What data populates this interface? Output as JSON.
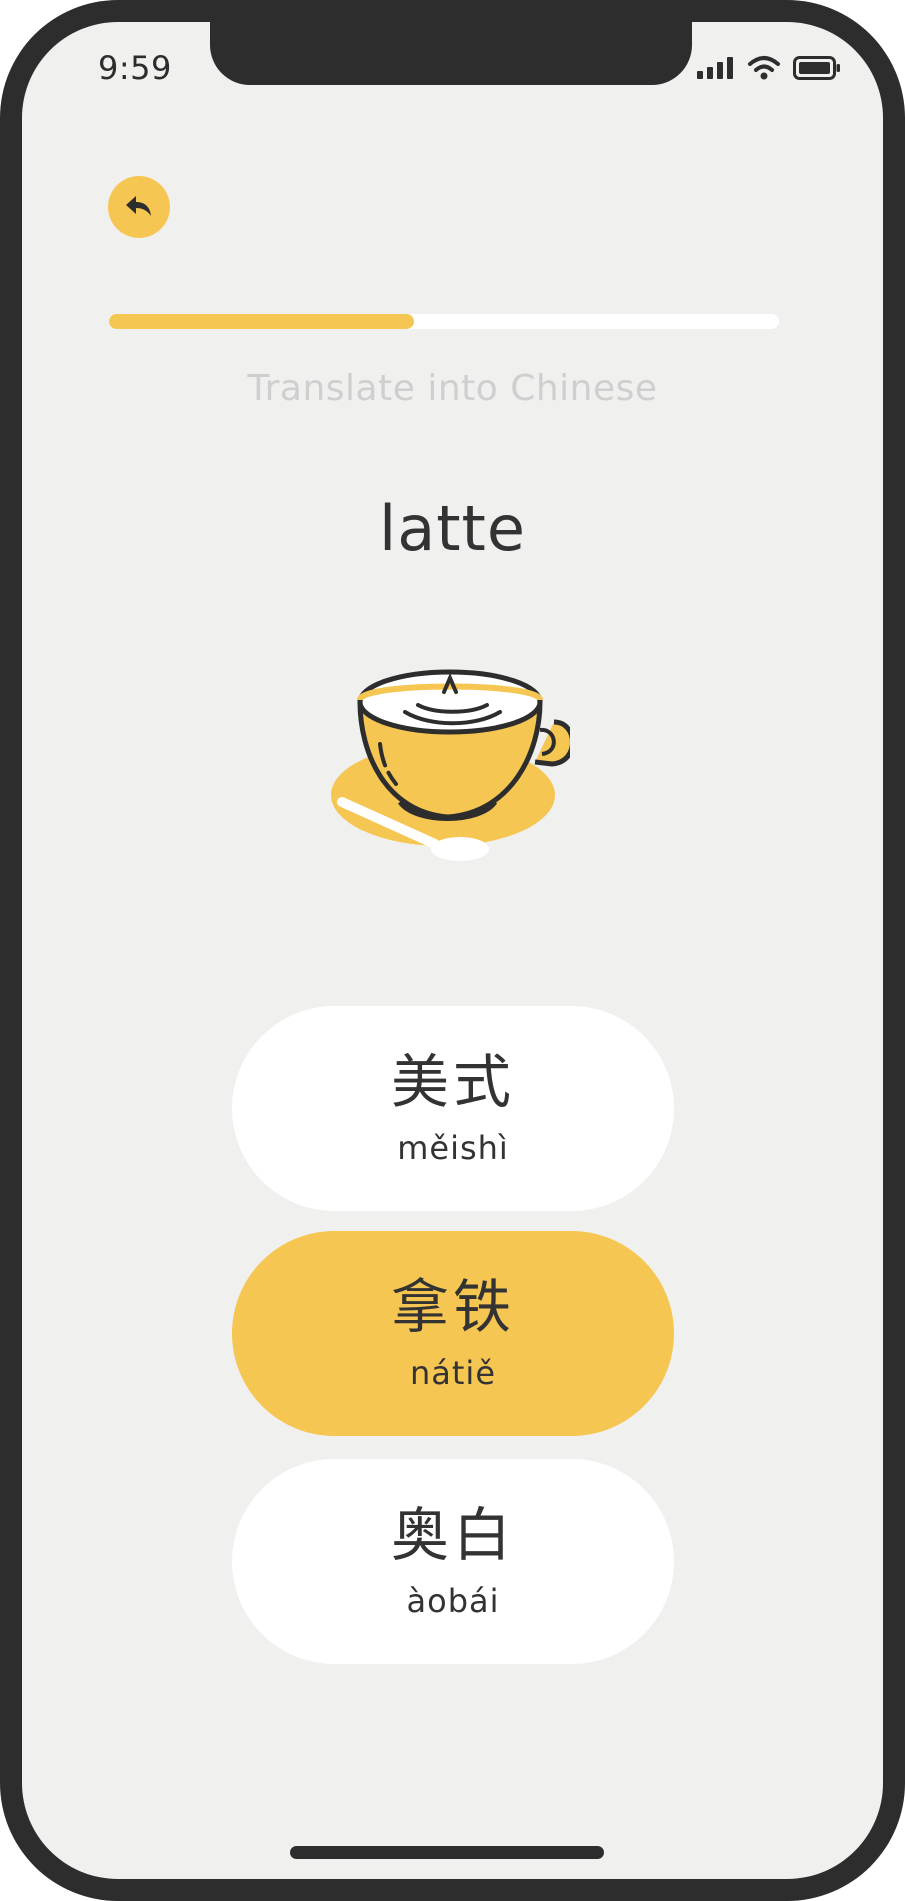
{
  "status_bar": {
    "time": "9:59"
  },
  "navigation": {
    "back_icon": "back-arrow-icon"
  },
  "progress": {
    "value": 0.455
  },
  "exercise": {
    "instruction": "Translate into Chinese",
    "word": "latte",
    "illustration": "latte-cup-icon"
  },
  "options": [
    {
      "hanzi": "美式",
      "pinyin": "měishì",
      "selected": false
    },
    {
      "hanzi": "拿铁",
      "pinyin": "nátiě",
      "selected": true
    },
    {
      "hanzi": "奥白",
      "pinyin": "àobái",
      "selected": false
    }
  ],
  "colors": {
    "accent": "#f6c653",
    "background": "#f0f0ef",
    "frame": "#2d2d2d",
    "text": "#333333",
    "muted_text": "#cfcfcf"
  }
}
